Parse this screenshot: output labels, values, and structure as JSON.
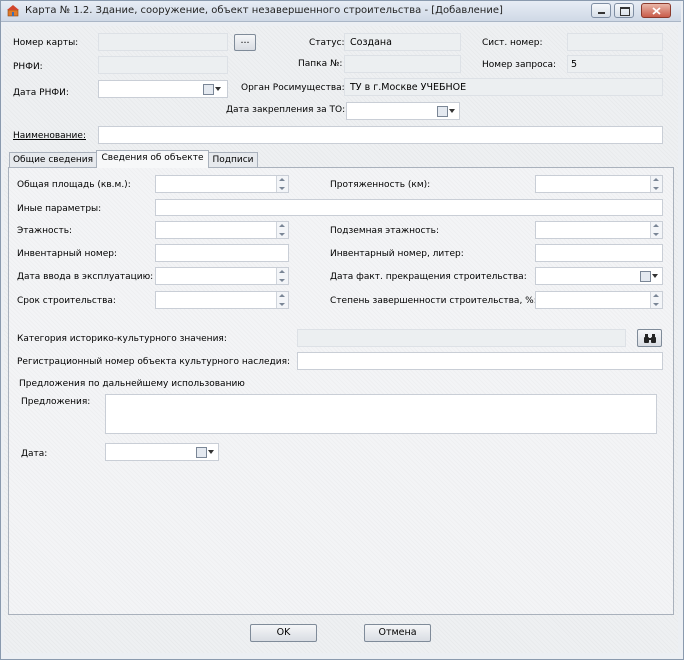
{
  "window": {
    "title": "Карта № 1.2. Здание, сооружение, объект незавершенного строительства - [Добавление]"
  },
  "header": {
    "card_number_label": "Номер карты:",
    "card_number_value": "",
    "browse_button": "...",
    "status_label": "Статус:",
    "status_value": "Создана",
    "sys_number_label": "Сист. номер:",
    "sys_number_value": "",
    "rnfi_label": "РНФИ:",
    "rnfi_value": "",
    "folder_label": "Папка №:",
    "folder_value": "",
    "request_number_label": "Номер запроса:",
    "request_number_value": "5",
    "rnfi_date_label": "Дата РНФИ:",
    "rnfi_date_value": "",
    "agency_label": "Орган Росимущества:",
    "agency_value": "ТУ в г.Москве УЧЕБНОЕ",
    "assign_date_label": "Дата закрепления за ТО:",
    "assign_date_value": "",
    "name_label": "Наименование:",
    "name_value": ""
  },
  "tabs": [
    {
      "label": "Общие сведения",
      "active": false
    },
    {
      "label": "Сведения об объекте",
      "active": true
    },
    {
      "label": "Подписи",
      "active": false
    }
  ],
  "object": {
    "total_area_label": "Общая площадь (кв.м.):",
    "total_area_value": "",
    "length_label": "Протяженность (км):",
    "length_value": "",
    "other_params_label": "Иные параметры:",
    "other_params_value": "",
    "floors_label": "Этажность:",
    "floors_value": "",
    "underground_label": "Подземная этажность:",
    "underground_value": "",
    "inventory_label": "Инвентарный номер:",
    "inventory_value": "",
    "inventory_letter_label": "Инвентарный номер, литер:",
    "inventory_letter_value": "",
    "commission_date_label": "Дата ввода в эксплуатацию:",
    "commission_date_value": "",
    "stop_date_label": "Дата факт. прекращения строительства:",
    "stop_date_value": "",
    "build_period_label": "Срок строительства:",
    "build_period_value": "",
    "completion_label": "Степень завершенности строительства, %:",
    "completion_value": "",
    "heritage_category_label": "Категория историко-культурного значения:",
    "heritage_category_value": "",
    "heritage_reg_label": "Регистрационный номер объекта культурного наследия:",
    "heritage_reg_value": "",
    "proposals_group_label": "Предложения по дальнейшему использованию",
    "proposals_label": "Предложения:",
    "proposals_value": "",
    "date_label": "Дата:",
    "date_value": ""
  },
  "footer": {
    "ok_label": "OK",
    "cancel_label": "Отмена"
  },
  "colors": {
    "window_border": "#8a9aae",
    "panel_bg": "#f3f4f6"
  }
}
